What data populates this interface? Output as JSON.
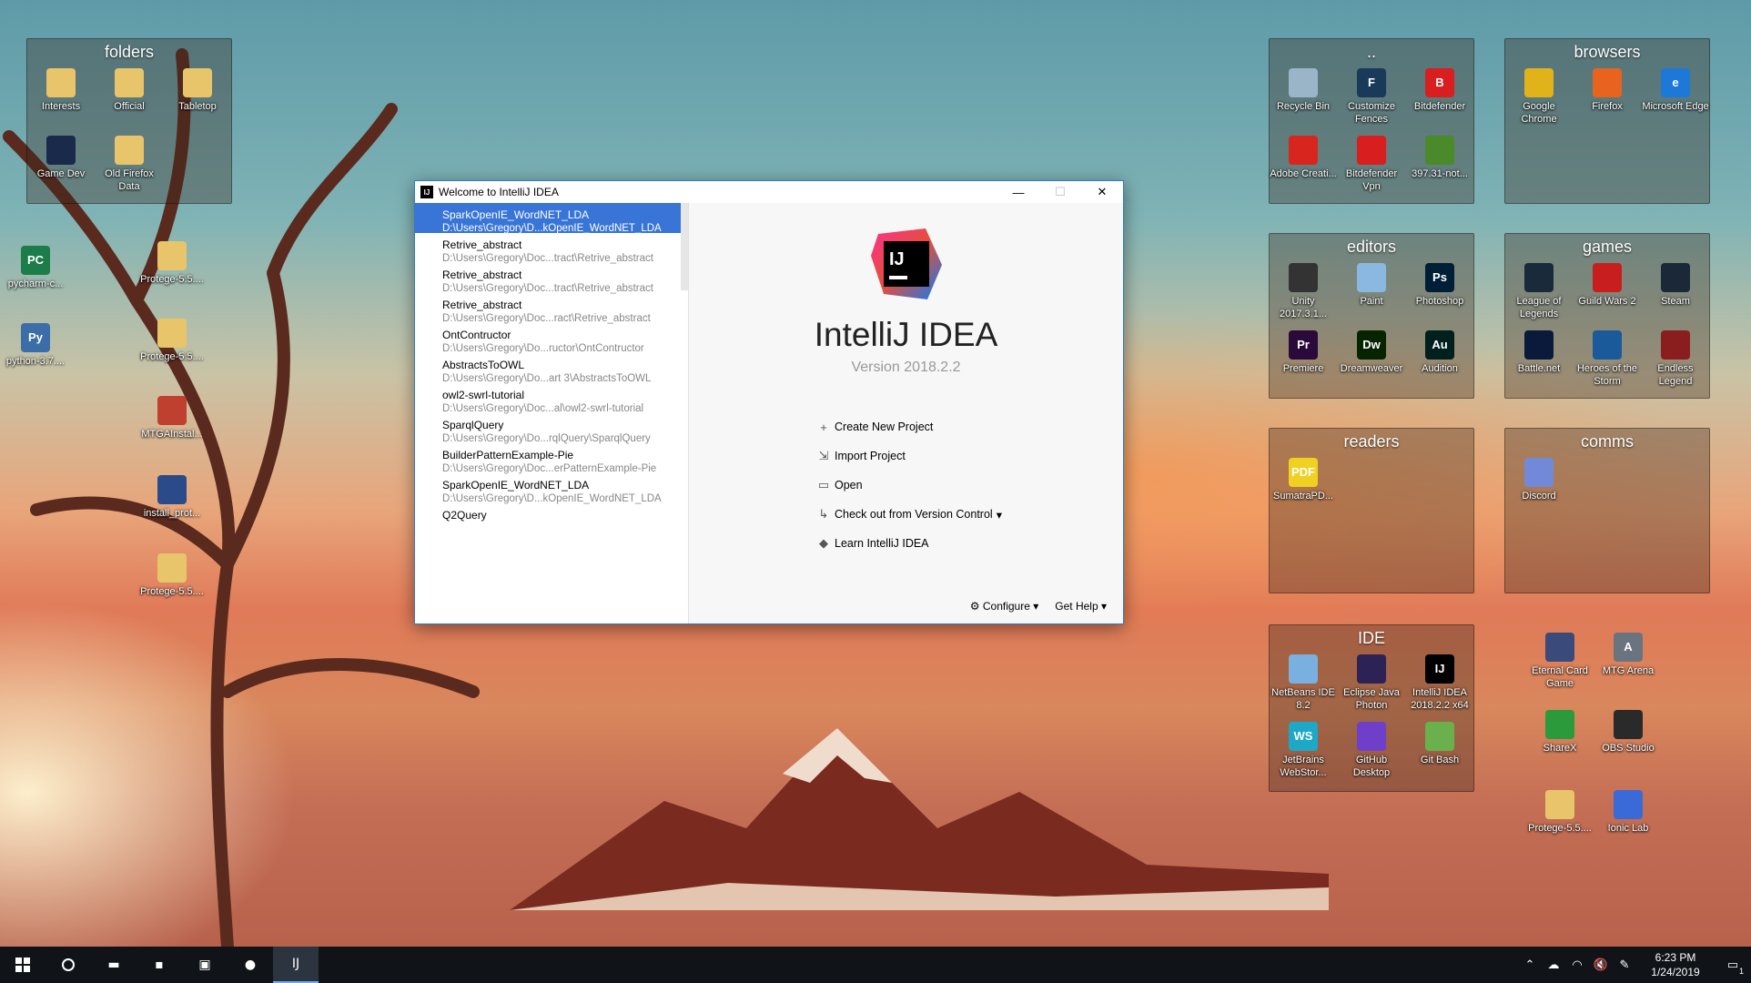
{
  "desktop": {
    "loose_icons": [
      {
        "label": "pycharm-c...",
        "glyph": "PC",
        "bg": "#1c7c4a"
      },
      {
        "label": "python-3.7....",
        "glyph": "Py",
        "bg": "#3b6ea8"
      },
      {
        "label": "Protege-5.5....",
        "glyph": "",
        "bg": "#e8c56a"
      },
      {
        "label": "Protege-5.5....",
        "glyph": "",
        "bg": "#e8c56a"
      },
      {
        "label": "MTGAInstal...",
        "glyph": "",
        "bg": "#c04030"
      },
      {
        "label": "install_prot...",
        "glyph": "",
        "bg": "#2a4a8a"
      },
      {
        "label": "Protege-5.5....",
        "glyph": "",
        "bg": "#e8c56a"
      },
      {
        "label": "Eternal Card Game",
        "glyph": "",
        "bg": "#3a4a7a"
      },
      {
        "label": "MTG Arena",
        "glyph": "A",
        "bg": "#6a7480"
      },
      {
        "label": "ShareX",
        "glyph": "",
        "bg": "#2a9a3a"
      },
      {
        "label": "OBS Studio",
        "glyph": "",
        "bg": "#2a2a2a"
      },
      {
        "label": "Protege-5.5....",
        "glyph": "",
        "bg": "#e8c56a"
      },
      {
        "label": "Ionic Lab",
        "glyph": "",
        "bg": "#3a6ad8"
      }
    ],
    "fences": [
      {
        "title": "folders",
        "icons": [
          {
            "label": "Interests",
            "bg": "#e8c56a"
          },
          {
            "label": "Official",
            "bg": "#e8c56a"
          },
          {
            "label": "Tabletop",
            "bg": "#e8c56a"
          },
          {
            "label": "Game Dev",
            "bg": "#1a2a4a"
          },
          {
            "label": "Old Firefox Data",
            "bg": "#e8c56a"
          }
        ]
      },
      {
        "title": "..",
        "icons": [
          {
            "label": "Recycle Bin",
            "bg": "#9ab4c8"
          },
          {
            "label": "Customize Fences",
            "bg": "#1a3a5a",
            "glyph": "F"
          },
          {
            "label": "Bitdefender",
            "bg": "#d81e1e",
            "glyph": "B"
          },
          {
            "label": "Adobe Creati...",
            "bg": "#d8261e"
          },
          {
            "label": "Bitdefender Vpn",
            "bg": "#d81e1e"
          },
          {
            "label": "397.31-not...",
            "bg": "#4a8a2a"
          }
        ]
      },
      {
        "title": "browsers",
        "icons": [
          {
            "label": "Google Chrome",
            "bg": "#e2b21a"
          },
          {
            "label": "Firefox",
            "bg": "#e8641e"
          },
          {
            "label": "Microsoft Edge",
            "bg": "#1e78d8",
            "glyph": "e"
          }
        ]
      },
      {
        "title": "editors",
        "icons": [
          {
            "label": "Unity 2017.3.1...",
            "bg": "#333333"
          },
          {
            "label": "Paint",
            "bg": "#8ab8e0"
          },
          {
            "label": "Photoshop",
            "bg": "#001e36",
            "glyph": "Ps"
          },
          {
            "label": "Premiere",
            "bg": "#2a0a3a",
            "glyph": "Pr"
          },
          {
            "label": "Dreamweaver",
            "bg": "#072401",
            "glyph": "Dw"
          },
          {
            "label": "Audition",
            "bg": "#00201e",
            "glyph": "Au"
          }
        ]
      },
      {
        "title": "games",
        "icons": [
          {
            "label": "League of Legends",
            "bg": "#1a2a3a"
          },
          {
            "label": "Guild Wars 2",
            "bg": "#c81e1e"
          },
          {
            "label": "Steam",
            "bg": "#1b2838"
          },
          {
            "label": "Battle.net",
            "bg": "#0a1a3a"
          },
          {
            "label": "Heroes of the Storm",
            "bg": "#1a5a9a"
          },
          {
            "label": "Endless Legend",
            "bg": "#8a1e1e"
          }
        ]
      },
      {
        "title": "readers",
        "icons": [
          {
            "label": "SumatraPD...",
            "bg": "#f0d020",
            "glyph": "PDF"
          }
        ]
      },
      {
        "title": "comms",
        "icons": [
          {
            "label": "Discord",
            "bg": "#7289da"
          }
        ]
      },
      {
        "title": "IDE",
        "icons": [
          {
            "label": "NetBeans IDE 8.2",
            "bg": "#7ab0e0"
          },
          {
            "label": "Eclipse Java Photon",
            "bg": "#2c2255"
          },
          {
            "label": "IntelliJ IDEA 2018.2.2 x64",
            "bg": "#000000",
            "glyph": "IJ"
          },
          {
            "label": "JetBrains WebStor...",
            "bg": "#1ea8c8",
            "glyph": "WS"
          },
          {
            "label": "GitHub Desktop",
            "bg": "#6e40c9"
          },
          {
            "label": "Git Bash",
            "bg": "#6ab04c"
          }
        ]
      }
    ]
  },
  "window": {
    "title": "Welcome to IntelliJ IDEA",
    "app_name": "IntelliJ IDEA",
    "version": "Version 2018.2.2",
    "recent_projects": [
      {
        "name": "SparkOpenIE_WordNET_LDA",
        "path": "D:\\Users\\Gregory\\D...kOpenIE_WordNET_LDA",
        "selected": true
      },
      {
        "name": "Retrive_abstract",
        "path": "D:\\Users\\Gregory\\Doc...tract\\Retrive_abstract"
      },
      {
        "name": "Retrive_abstract",
        "path": "D:\\Users\\Gregory\\Doc...tract\\Retrive_abstract"
      },
      {
        "name": "Retrive_abstract",
        "path": "D:\\Users\\Gregory\\Doc...ract\\Retrive_abstract"
      },
      {
        "name": "OntContructor",
        "path": "D:\\Users\\Gregory\\Do...ructor\\OntContructor"
      },
      {
        "name": "AbstractsToOWL",
        "path": "D:\\Users\\Gregory\\Do...art 3\\AbstractsToOWL"
      },
      {
        "name": "owl2-swrl-tutorial",
        "path": "D:\\Users\\Gregory\\Doc...al\\owl2-swrl-tutorial"
      },
      {
        "name": "SparqlQuery",
        "path": "D:\\Users\\Gregory\\Do...rqlQuery\\SparqlQuery"
      },
      {
        "name": "BuilderPatternExample-Pie",
        "path": "D:\\Users\\Gregory\\Doc...erPatternExample-Pie"
      },
      {
        "name": "SparkOpenIE_WordNET_LDA",
        "path": "D:\\Users\\Gregory\\D...kOpenIE_WordNET_LDA"
      },
      {
        "name": "Q2Query",
        "path": ""
      }
    ],
    "actions": [
      {
        "label": "Create New Project",
        "icon": "plus-icon",
        "glyph": "+"
      },
      {
        "label": "Import Project",
        "icon": "import-icon",
        "glyph": "⇲"
      },
      {
        "label": "Open",
        "icon": "folder-icon",
        "glyph": "▭"
      },
      {
        "label": "Check out from Version Control",
        "icon": "vcs-checkout-icon",
        "glyph": "↳",
        "dropdown": "▾"
      },
      {
        "label": "Learn IntelliJ IDEA",
        "icon": "learn-icon",
        "glyph": "◆"
      }
    ],
    "configure_label": "Configure",
    "get_help_label": "Get Help",
    "dropdown_glyph": "▾",
    "minimize_glyph": "—",
    "maximize_glyph": "☐",
    "close_glyph": "✕",
    "logo_glyph": "IJ"
  },
  "taskbar": {
    "time": "6:23 PM",
    "date": "1/24/2019",
    "notification_count": "1",
    "apps": [
      {
        "name": "file-explorer",
        "glyph": "▬"
      },
      {
        "name": "paint-app",
        "glyph": "▪"
      },
      {
        "name": "remote-desktop",
        "glyph": "▣"
      },
      {
        "name": "chrome",
        "glyph": "●"
      },
      {
        "name": "intellij",
        "glyph": "IJ",
        "active": true
      }
    ]
  }
}
